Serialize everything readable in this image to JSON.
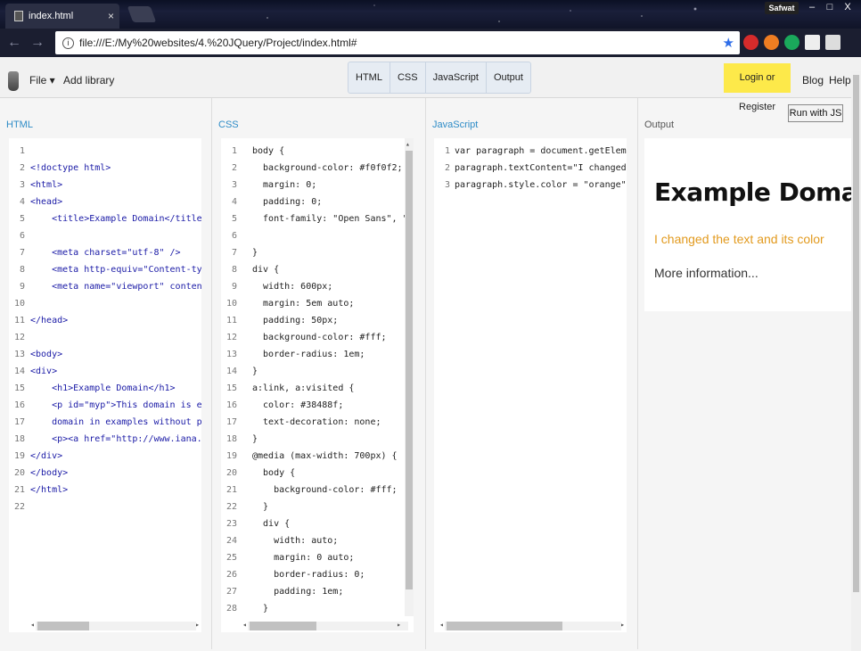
{
  "browser": {
    "tab_title": "index.html",
    "tab_close": "×",
    "url": "file:///E:/My%20websites/4.%20JQuery/Project/index.html#",
    "user": "Safwat",
    "win_minimize": "–",
    "win_restore": "□",
    "win_close": "X"
  },
  "header": {
    "file_menu": "File ▾",
    "add_library": "Add library",
    "tabs": [
      "HTML",
      "CSS",
      "JavaScript",
      "Output"
    ],
    "login": "Login or Register",
    "blog": "Blog",
    "help": "Help"
  },
  "panels": {
    "html_title": "HTML",
    "css_title": "CSS",
    "js_title": "JavaScript",
    "output_title": "Output"
  },
  "run_button": "Run with JS",
  "html_code": [
    "",
    "<!doctype html>",
    "<html>",
    "<head>",
    "    <title>Example Domain</title>",
    "",
    "    <meta charset=\"utf-8\" />",
    "    <meta http-equiv=\"Content-type\" co",
    "    <meta name=\"viewport\" content=\"wid",
    "",
    "</head>",
    "",
    "<body>",
    "<div>",
    "    <h1>Example Domain</h1>",
    "    <p id=\"myp\">This domain is establi",
    "    domain in examples without prior c",
    "    <p><a href=\"http://www.iana.org/do",
    "</div>",
    "</body>",
    "</html>",
    ""
  ],
  "css_code": [
    "body {",
    "  background-color: #f0f0f2;",
    "  margin: 0;",
    "  padding: 0;",
    "  font-family: \"Open Sans\", \"Helve",
    "",
    "}",
    "div {",
    "  width: 600px;",
    "  margin: 5em auto;",
    "  padding: 50px;",
    "  background-color: #fff;",
    "  border-radius: 1em;",
    "}",
    "a:link, a:visited {",
    "  color: #38488f;",
    "  text-decoration: none;",
    "}",
    "@media (max-width: 700px) {",
    "  body {",
    "    background-color: #fff;",
    "  }",
    "  div {",
    "    width: auto;",
    "    margin: 0 auto;",
    "    border-radius: 0;",
    "    padding: 1em;",
    "  }",
    ""
  ],
  "js_code": [
    "var paragraph = document.getElementById(",
    "paragraph.textContent=\"I changed the t",
    "paragraph.style.color = \"orange\";"
  ],
  "output": {
    "heading": "Example Domain",
    "paragraph": "I changed the text and its color",
    "link": "More information..."
  },
  "colors": {
    "login_button": "#fde94a",
    "output_paragraph": "#e29a1e",
    "panel_title": "#2e8cc7"
  }
}
